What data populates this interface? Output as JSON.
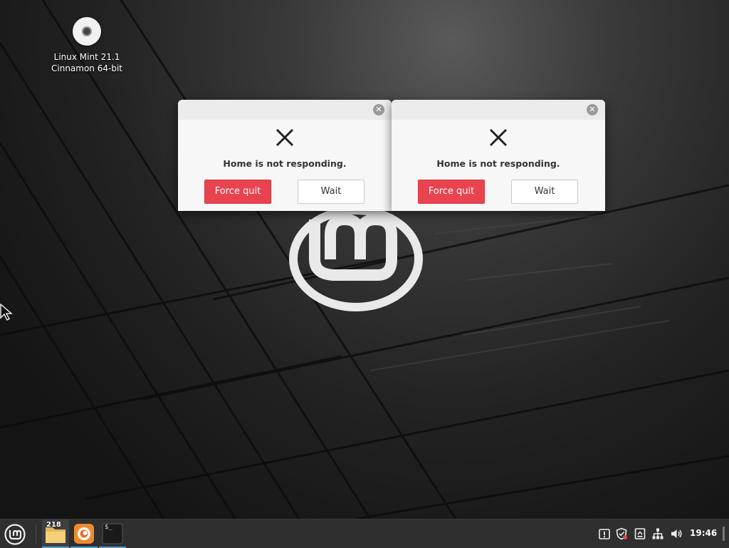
{
  "desktop": {
    "icon": {
      "line1": "Linux Mint 21.1",
      "line2": "Cinnamon 64-bit"
    }
  },
  "dialogs": [
    {
      "message": "Home is not responding.",
      "force_quit_label": "Force quit",
      "wait_label": "Wait",
      "close_glyph": "✕"
    },
    {
      "message": "Home is not responding.",
      "force_quit_label": "Force quit",
      "wait_label": "Wait",
      "close_glyph": "✕"
    }
  ],
  "taskbar": {
    "apps": [
      {
        "icon": "folder-icon",
        "badge": "218"
      },
      {
        "icon": "firefox-icon"
      },
      {
        "icon": "terminal-icon",
        "glyph": "$_"
      }
    ],
    "tray": [
      "notifications-icon",
      "update-shield-icon",
      "clipboard-icon",
      "network-icon",
      "volume-icon"
    ],
    "clock": "19:46"
  },
  "colors": {
    "force_quit": "#e8434f",
    "taskbar": "#2f2f2f",
    "active_underline": "#4aa3d8"
  }
}
